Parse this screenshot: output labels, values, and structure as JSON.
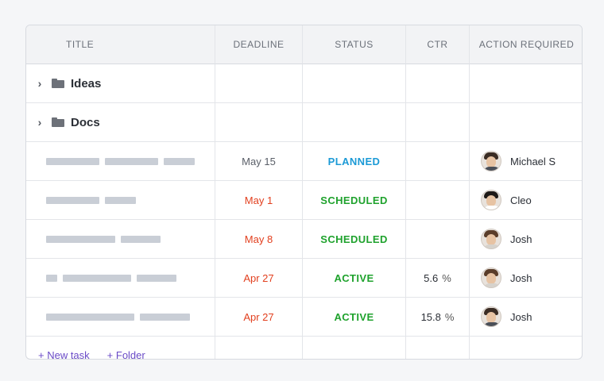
{
  "columns": [
    "TITLE",
    "DEADLINE",
    "STATUS",
    "CTR",
    "ACTION REQUIRED"
  ],
  "folders": [
    {
      "name": "Ideas",
      "icon": "folder-icon"
    },
    {
      "name": "Docs",
      "icon": "folder-icon"
    }
  ],
  "tasks": [
    {
      "deadline": "May 15",
      "deadline_color": "#5b6069",
      "status": "PLANNED",
      "status_color": "#1c9ad6",
      "ctr": "",
      "ctr_unit": "",
      "assignee": "Michael S",
      "avatar_hair": "#3a2c24",
      "avatar_shirt": "#4a4f58"
    },
    {
      "deadline": "May 1",
      "deadline_color": "#e2401f",
      "status": "SCHEDULED",
      "status_color": "#1fa22d",
      "ctr": "",
      "ctr_unit": "",
      "assignee": "Cleo",
      "avatar_hair": "#1e1a18",
      "avatar_shirt": "#ffffff"
    },
    {
      "deadline": "May 8",
      "deadline_color": "#e2401f",
      "status": "SCHEDULED",
      "status_color": "#1fa22d",
      "ctr": "",
      "ctr_unit": "",
      "assignee": "Josh",
      "avatar_hair": "#5a3d2a",
      "avatar_shirt": "#d6d2cc"
    },
    {
      "deadline": "Apr 27",
      "deadline_color": "#e2401f",
      "status": "ACTIVE",
      "status_color": "#1fa22d",
      "ctr": "5.6",
      "ctr_unit": "%",
      "assignee": "Josh",
      "avatar_hair": "#5a3d2a",
      "avatar_shirt": "#d6d2cc"
    },
    {
      "deadline": "Apr 27",
      "deadline_color": "#e2401f",
      "status": "ACTIVE",
      "status_color": "#1fa22d",
      "ctr": "15.8",
      "ctr_unit": "%",
      "assignee": "Josh",
      "avatar_hair": "#3a2c24",
      "avatar_shirt": "#4a4f58"
    }
  ],
  "footer": {
    "new_task": "+ New task",
    "new_folder": "+ Folder"
  }
}
